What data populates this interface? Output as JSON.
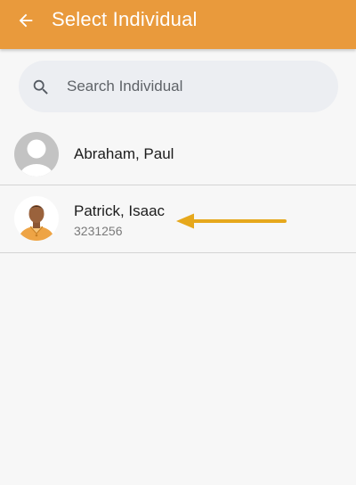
{
  "appbar": {
    "title": "Select Individual",
    "background_color": "#e99a3c",
    "back_icon": "arrow-back-icon"
  },
  "search": {
    "placeholder": "Search Individual",
    "value": "",
    "icon": "search-icon"
  },
  "individuals": [
    {
      "name": "Abraham, Paul",
      "id": "",
      "avatar": "default-avatar"
    },
    {
      "name": "Patrick, Isaac",
      "id": "3231256",
      "avatar": "photo-avatar"
    }
  ],
  "annotation": {
    "icon": "pointer-arrow-icon",
    "color": "#e6a81c"
  }
}
